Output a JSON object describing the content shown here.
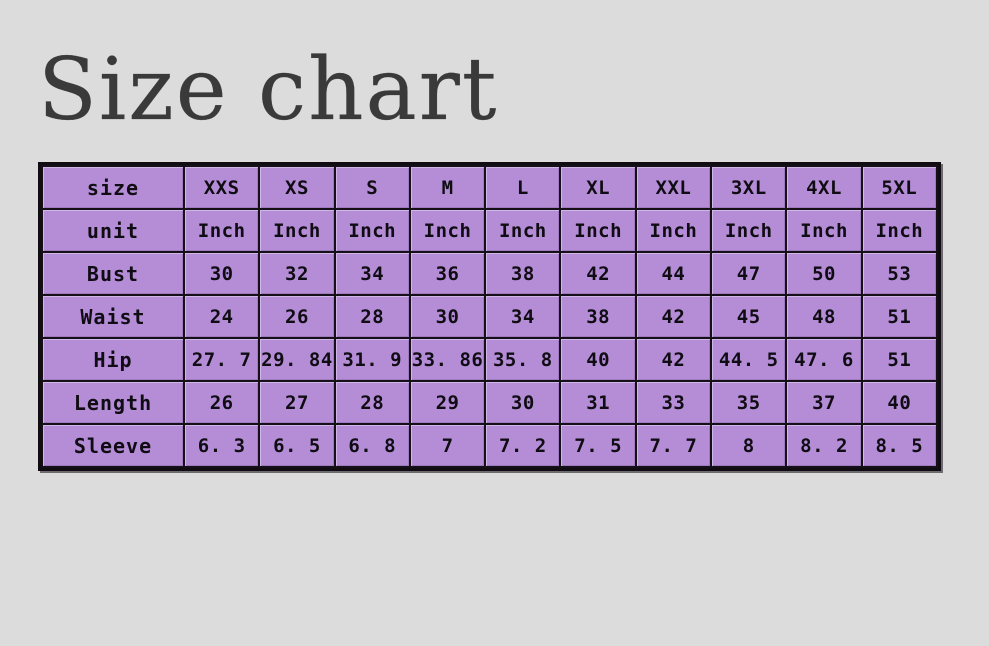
{
  "title": "Size chart",
  "colors": {
    "background": "#dcdcdc",
    "cell_fill": "#b48dd6",
    "grid": "#151018",
    "text": "#100c14",
    "title_text": "#3a3a3a"
  },
  "chart_data": {
    "type": "table",
    "title": "Size chart",
    "columns": [
      "size",
      "XXS",
      "XS",
      "S",
      "M",
      "L",
      "XL",
      "XXL",
      "3XL",
      "4XL",
      "5XL"
    ],
    "rows": [
      {
        "label": "size",
        "values": [
          "XXS",
          "XS",
          "S",
          "M",
          "L",
          "XL",
          "XXL",
          "3XL",
          "4XL",
          "5XL"
        ]
      },
      {
        "label": "unit",
        "values": [
          "Inch",
          "Inch",
          "Inch",
          "Inch",
          "Inch",
          "Inch",
          "Inch",
          "Inch",
          "Inch",
          "Inch"
        ]
      },
      {
        "label": "Bust",
        "values": [
          "30",
          "32",
          "34",
          "36",
          "38",
          "42",
          "44",
          "47",
          "50",
          "53"
        ]
      },
      {
        "label": "Waist",
        "values": [
          "24",
          "26",
          "28",
          "30",
          "34",
          "38",
          "42",
          "45",
          "48",
          "51"
        ]
      },
      {
        "label": "Hip",
        "values": [
          "27. 7",
          "29. 84",
          "31. 9",
          "33. 86",
          "35. 8",
          "40",
          "42",
          "44. 5",
          "47. 6",
          "51"
        ]
      },
      {
        "label": "Length",
        "values": [
          "26",
          "27",
          "28",
          "29",
          "30",
          "31",
          "33",
          "35",
          "37",
          "40"
        ]
      },
      {
        "label": "Sleeve",
        "values": [
          "6. 3",
          "6. 5",
          "6. 8",
          "7",
          "7. 2",
          "7. 5",
          "7. 7",
          "8",
          "8. 2",
          "8. 5"
        ]
      }
    ],
    "units": "Inch",
    "measurements": {
      "Bust": {
        "XXS": 30,
        "XS": 32,
        "S": 34,
        "M": 36,
        "L": 38,
        "XL": 42,
        "XXL": 44,
        "3XL": 47,
        "4XL": 50,
        "5XL": 53
      },
      "Waist": {
        "XXS": 24,
        "XS": 26,
        "S": 28,
        "M": 30,
        "L": 34,
        "XL": 38,
        "XXL": 42,
        "3XL": 45,
        "4XL": 48,
        "5XL": 51
      },
      "Hip": {
        "XXS": 27.7,
        "XS": 29.84,
        "S": 31.9,
        "M": 33.86,
        "L": 35.8,
        "XL": 40,
        "XXL": 42,
        "3XL": 44.5,
        "4XL": 47.6,
        "5XL": 51
      },
      "Length": {
        "XXS": 26,
        "XS": 27,
        "S": 28,
        "M": 29,
        "L": 30,
        "XL": 31,
        "XXL": 33,
        "3XL": 35,
        "4XL": 37,
        "5XL": 40
      },
      "Sleeve": {
        "XXS": 6.3,
        "XS": 6.5,
        "S": 6.8,
        "M": 7,
        "L": 7.2,
        "XL": 7.5,
        "XXL": 7.7,
        "3XL": 8,
        "4XL": 8.2,
        "5XL": 8.5
      }
    }
  }
}
